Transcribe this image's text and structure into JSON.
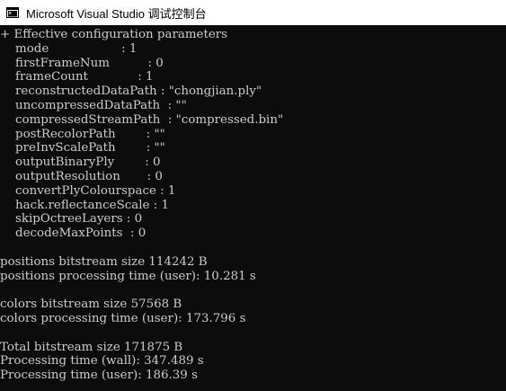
{
  "window": {
    "title": "Microsoft Visual Studio 调试控制台",
    "icon": "console-app-icon"
  },
  "console": {
    "lines": [
      "+ Effective configuration parameters",
      "    mode                   : 1",
      "    firstFrameNum          : 0",
      "    frameCount             : 1",
      "    reconstructedDataPath : \"chongjian.ply\"",
      "    uncompressedDataPath  : \"\"",
      "    compressedStreamPath  : \"compressed.bin\"",
      "    postRecolorPath        : \"\"",
      "    preInvScalePath        : \"\"",
      "    outputBinaryPly        : 0",
      "    outputResolution       : 0",
      "    convertPlyColourspace : 1",
      "    hack.reflectanceScale : 1",
      "    skipOctreeLayers : 0",
      "    decodeMaxPoints  : 0",
      "",
      "positions bitstream size 114242 B",
      "positions processing time (user): 10.281 s",
      "",
      "colors bitstream size 57568 B",
      "colors processing time (user): 173.796 s",
      "",
      "Total bitstream size 171875 B",
      "Processing time (wall): 347.489 s",
      "Processing time (user): 186.39 s"
    ]
  }
}
